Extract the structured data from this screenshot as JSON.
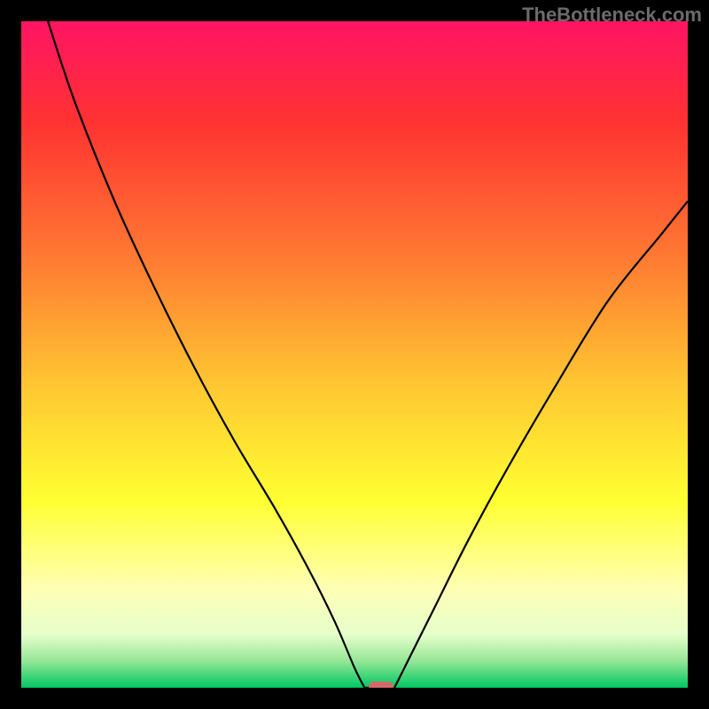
{
  "watermark": "TheBottleneck.com",
  "chart_data": {
    "type": "line",
    "title": "",
    "xlabel": "",
    "ylabel": "",
    "xlim": [
      0,
      100
    ],
    "ylim": [
      0,
      100
    ],
    "curve": {
      "left_branch": [
        {
          "x": 4,
          "y": 100
        },
        {
          "x": 8,
          "y": 88
        },
        {
          "x": 14,
          "y": 73
        },
        {
          "x": 20,
          "y": 60
        },
        {
          "x": 26,
          "y": 48
        },
        {
          "x": 32,
          "y": 37
        },
        {
          "x": 38,
          "y": 27
        },
        {
          "x": 43,
          "y": 18
        },
        {
          "x": 47,
          "y": 10
        },
        {
          "x": 50,
          "y": 3
        },
        {
          "x": 51.5,
          "y": 0
        }
      ],
      "flat_bottom": [
        {
          "x": 51.5,
          "y": 0
        },
        {
          "x": 56,
          "y": 0
        }
      ],
      "right_branch": [
        {
          "x": 56,
          "y": 0
        },
        {
          "x": 58,
          "y": 4
        },
        {
          "x": 62,
          "y": 12
        },
        {
          "x": 67,
          "y": 22
        },
        {
          "x": 73,
          "y": 33
        },
        {
          "x": 80,
          "y": 45
        },
        {
          "x": 88,
          "y": 58
        },
        {
          "x": 96,
          "y": 68
        },
        {
          "x": 100,
          "y": 73
        }
      ]
    },
    "marker": {
      "x": 54,
      "y": 0,
      "color": "#d36a6a"
    },
    "gradient_stops": [
      {
        "offset": 0,
        "color": "#ff1464"
      },
      {
        "offset": 0.15,
        "color": "#ff3232"
      },
      {
        "offset": 0.35,
        "color": "#ff7832"
      },
      {
        "offset": 0.55,
        "color": "#ffc832"
      },
      {
        "offset": 0.72,
        "color": "#ffff32"
      },
      {
        "offset": 0.85,
        "color": "#ffffb4"
      },
      {
        "offset": 0.92,
        "color": "#e6ffcc"
      },
      {
        "offset": 0.96,
        "color": "#96e696"
      },
      {
        "offset": 1.0,
        "color": "#00c864"
      }
    ]
  }
}
